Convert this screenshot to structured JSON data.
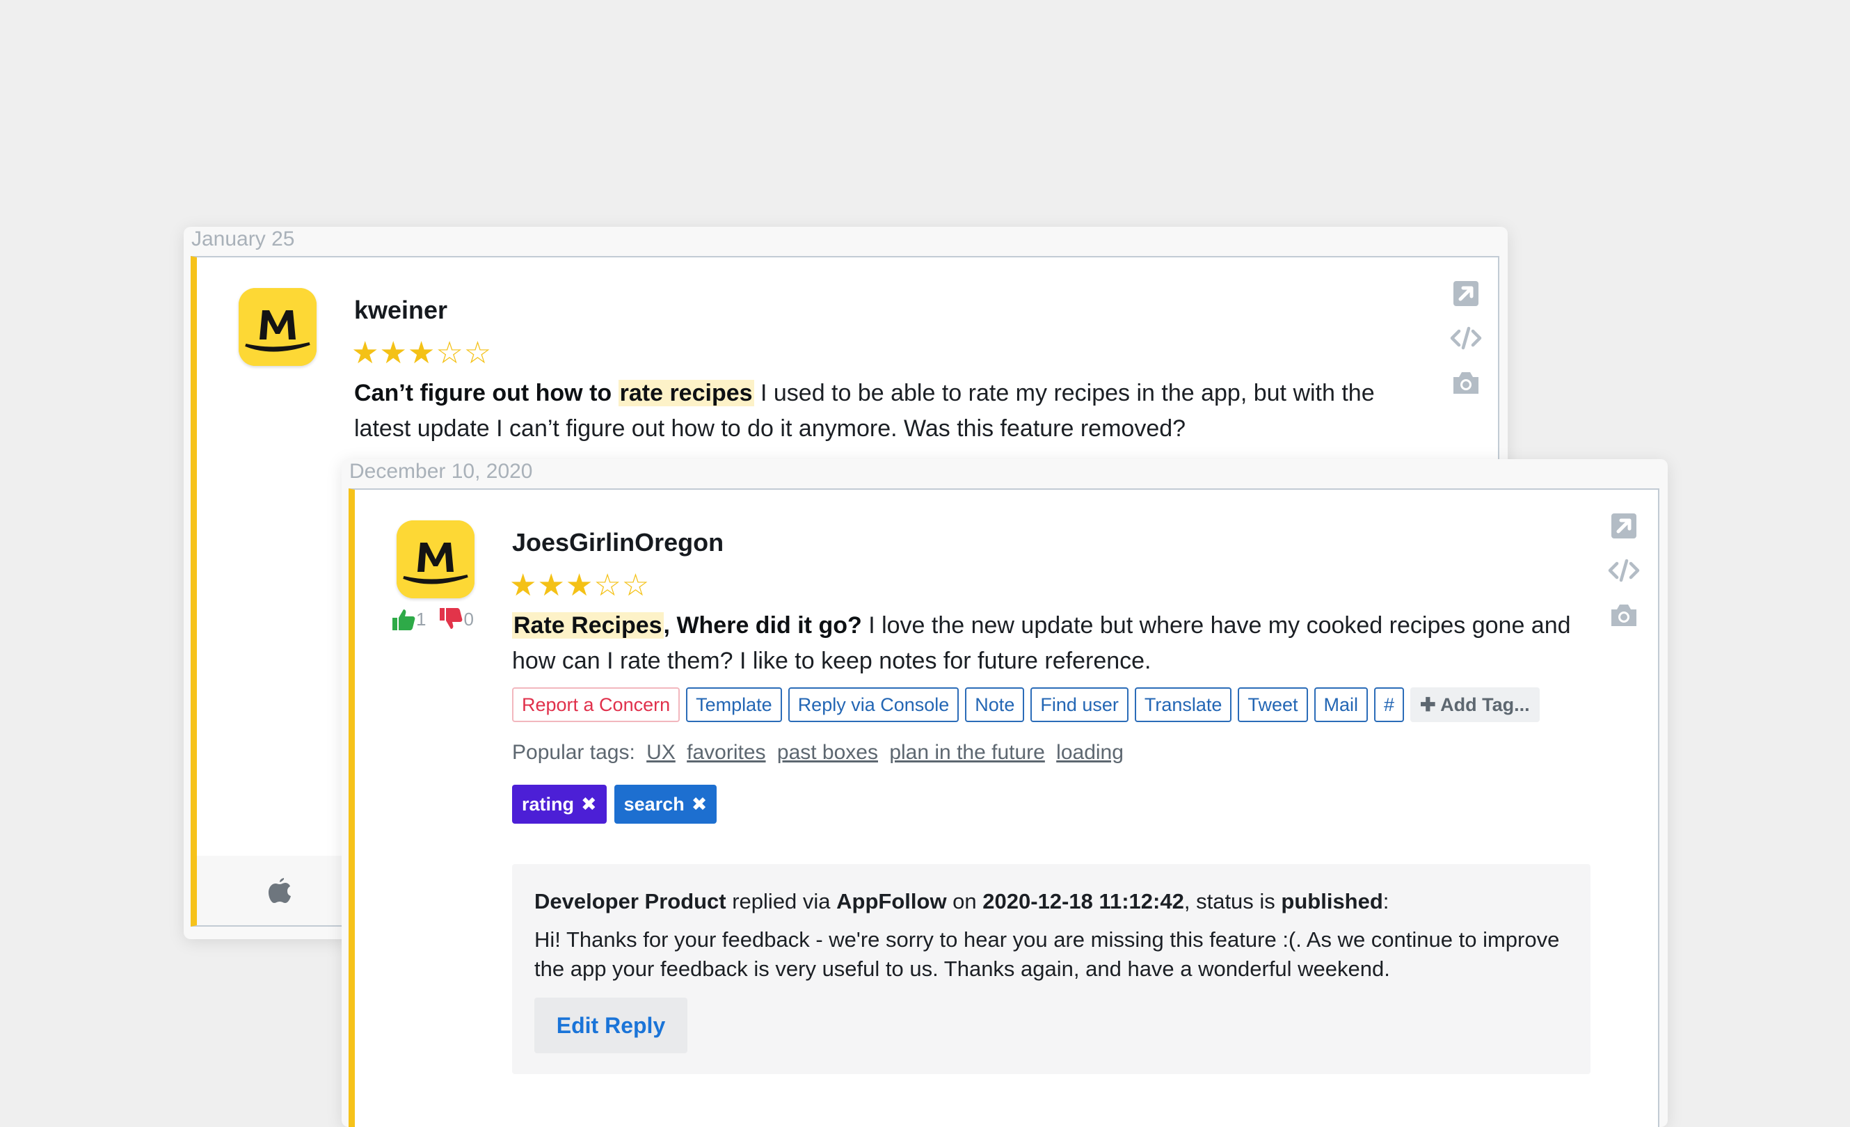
{
  "colors": {
    "background": "#efefef",
    "accent_border": "#f6c21a",
    "star": "#f4c116",
    "link_blue": "#2366b4",
    "concern_red": "#e0304b",
    "tag_rating": "#4c1fd6",
    "tag_search": "#1d6fd0",
    "thumb_up": "#2eaa48",
    "thumb_down": "#e2344a"
  },
  "reviews": [
    {
      "date": "January 25",
      "username": "kweiner",
      "stars": "★★★☆☆",
      "rating": 3,
      "title_before": "Can’t figure out how to ",
      "title_highlight": "rate recipes",
      "body": " I used to be able to rate my recipes in the app, but with the latest update I can’t figure out how to do it anymore. Was this feature removed?",
      "platform_icon": "apple-icon"
    },
    {
      "date": "December 10, 2020",
      "username": "JoesGirlinOregon",
      "stars": "★★★☆☆",
      "rating": 3,
      "votes_up": "1",
      "votes_down": "0",
      "title_highlight": "Rate Recipes",
      "title_after": ", Where did it go?",
      "body": " I love the new update but where have my cooked recipes gone and how can I rate them? I like to keep notes for future reference.",
      "actions": {
        "report": "Report a Concern",
        "template": "Template",
        "reply_console": "Reply via Console",
        "note": "Note",
        "find_user": "Find user",
        "translate": "Translate",
        "tweet": "Tweet",
        "mail": "Mail",
        "hash": "#",
        "add_tag": "✚ Add Tag..."
      },
      "popular_tags_label": "Popular tags:",
      "popular_tags": [
        "UX",
        "favorites",
        "past boxes",
        "plan in the future",
        "loading"
      ],
      "tags": [
        {
          "label": "rating",
          "color": "#4c1fd6"
        },
        {
          "label": "search",
          "color": "#1d6fd0"
        }
      ],
      "reply": {
        "author": "Developer Product",
        "replied_via": " replied via ",
        "service": "AppFollow",
        "on": " on ",
        "datetime": "2020-12-18 11:12:42",
        "status_is": ", status is ",
        "status": "published",
        "colon": ":",
        "text": "Hi! Thanks for your feedback - we're sorry to hear you are missing this feature :(. As we continue to improve the app your feedback is very useful to us. Thanks again, and have a wonderful weekend.",
        "edit_label": "Edit Reply"
      }
    }
  ]
}
